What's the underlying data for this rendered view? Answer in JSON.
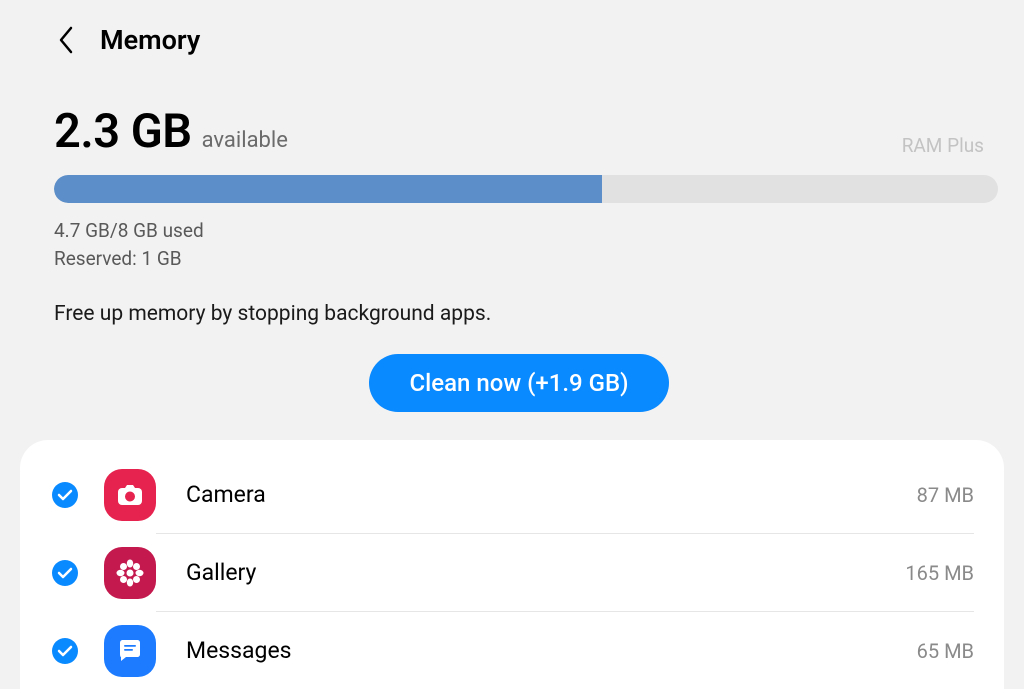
{
  "header": {
    "title": "Memory"
  },
  "status": {
    "available_size": "2.3 GB",
    "available_label": "available",
    "ram_plus": "RAM Plus",
    "progress_percent": 58,
    "used_line": "4.7 GB/8 GB used",
    "reserved_line": "Reserved: 1 GB",
    "description": "Free up memory by stopping background apps."
  },
  "clean_button": {
    "label": "Clean now (+1.9 GB)"
  },
  "apps": [
    {
      "name": "Camera",
      "size": "87 MB",
      "icon": "camera",
      "checked": true
    },
    {
      "name": "Gallery",
      "size": "165 MB",
      "icon": "gallery",
      "checked": true
    },
    {
      "name": "Messages",
      "size": "65 MB",
      "icon": "messages",
      "checked": true
    }
  ]
}
